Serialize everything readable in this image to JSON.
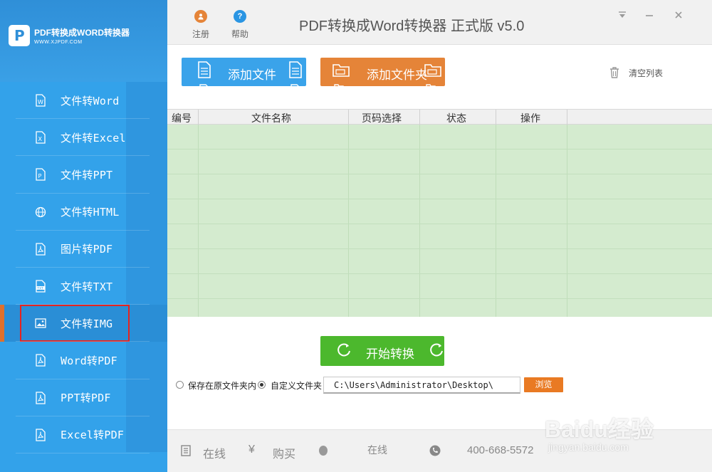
{
  "app": {
    "title": "PDF转换成Word转换器 正式版 v5.0",
    "logo_title": "PDF转换成WORD转换器",
    "logo_url": "WWW.XJPDF.COM"
  },
  "topbar": {
    "register_label": "注册",
    "help_label": "帮助"
  },
  "sidebar": {
    "items": [
      {
        "label": "文件转Word",
        "icon": "word-file-icon"
      },
      {
        "label": "文件转Excel",
        "icon": "excel-file-icon"
      },
      {
        "label": "文件转PPT",
        "icon": "ppt-file-icon"
      },
      {
        "label": "文件转HTML",
        "icon": "globe-icon"
      },
      {
        "label": "图片转PDF",
        "icon": "pdf-file-icon"
      },
      {
        "label": "文件转TXT",
        "icon": "txt-file-icon"
      },
      {
        "label": "文件转IMG",
        "icon": "image-icon",
        "active": true
      },
      {
        "label": "Word转PDF",
        "icon": "pdf-file-icon"
      },
      {
        "label": "PPT转PDF",
        "icon": "pdf-file-icon"
      },
      {
        "label": "Excel转PDF",
        "icon": "pdf-file-icon"
      }
    ]
  },
  "toolbar": {
    "add_file_label": "添加文件",
    "add_folder_label": "添加文件夹",
    "clear_list_label": "清空列表"
  },
  "table": {
    "headers": [
      "编号",
      "文件名称",
      "页码选择",
      "状态",
      "操作"
    ],
    "rows": []
  },
  "convert": {
    "start_label": "开始转换"
  },
  "output": {
    "option_original": "保存在原文件夹内",
    "option_custom": "自定义文件夹",
    "path_value": "C:\\Users\\Administrator\\Desktop\\",
    "browse_label": "浏览"
  },
  "footer": {
    "online_label": "在线",
    "buy_label": "购买",
    "status_label": "在线",
    "phone": "400-668-5572"
  },
  "watermark": {
    "brand": "Baidu经验",
    "url": "jingyan.baidu.com"
  },
  "colors": {
    "sidebar": "#33a2ea",
    "add_file": "#3aa3ea",
    "add_folder": "#e58438",
    "convert": "#4cb82d",
    "browse": "#e97a23",
    "table_bg": "#d4ebcf",
    "highlight_border": "#e5231f"
  }
}
